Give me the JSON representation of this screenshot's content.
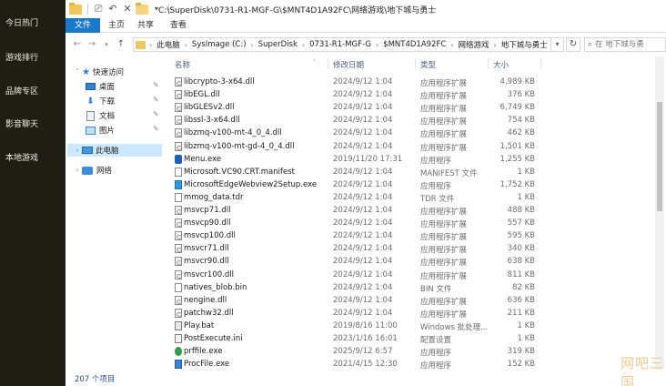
{
  "launcher": {
    "items": [
      "今日热门",
      "游戏排行",
      "品牌专区",
      "影音聊天",
      "本地游戏"
    ]
  },
  "titlebar": {
    "path": "C:\\SuperDisk\\0731-R1-MGF-G\\$MNT4D1A92FC\\网络游戏\\地下城与勇士",
    "qa_dropdown_icon": "chevron-down-icon"
  },
  "ribbon": {
    "tabs": [
      "文件",
      "主页",
      "共享",
      "查看"
    ]
  },
  "address": {
    "crumbs": [
      "此电脑",
      "SysImage (C:)",
      "SuperDisk",
      "0731-R1-MGF-G",
      "$MNT4D1A92FC",
      "网络游戏",
      "地下城与勇士"
    ],
    "search_placeholder": "在 地下城与勇"
  },
  "navpane": {
    "quick_access": "快速访问",
    "desktop": "桌面",
    "downloads": "下载",
    "documents": "文档",
    "pictures": "图片",
    "this_pc": "此电脑",
    "network": "网络"
  },
  "columns": {
    "name": "名称",
    "date": "修改日期",
    "type": "类型",
    "size": "大小"
  },
  "files": [
    {
      "name": "libcrypto-3-x64.dll",
      "date": "2024/9/12 1:04",
      "type": "应用程序扩展",
      "size": "4,989 KB",
      "icon": "dll"
    },
    {
      "name": "libEGL.dll",
      "date": "2024/9/12 1:04",
      "type": "应用程序扩展",
      "size": "376 KB",
      "icon": "dll"
    },
    {
      "name": "libGLESv2.dll",
      "date": "2024/9/12 1:04",
      "type": "应用程序扩展",
      "size": "6,749 KB",
      "icon": "dll"
    },
    {
      "name": "libssl-3-x64.dll",
      "date": "2024/9/12 1:04",
      "type": "应用程序扩展",
      "size": "754 KB",
      "icon": "dll"
    },
    {
      "name": "libzmq-v100-mt-4_0_4.dll",
      "date": "2024/9/12 1:04",
      "type": "应用程序扩展",
      "size": "462 KB",
      "icon": "dll"
    },
    {
      "name": "libzmq-v100-mt-gd-4_0_4.dll",
      "date": "2024/9/12 1:04",
      "type": "应用程序扩展",
      "size": "1,501 KB",
      "icon": "dll"
    },
    {
      "name": "Menu.exe",
      "date": "2019/11/20 17:31",
      "type": "应用程序",
      "size": "1,255 KB",
      "icon": "menu"
    },
    {
      "name": "Microsoft.VC90.CRT.manifest",
      "date": "2024/9/12 1:04",
      "type": "MANIFEST 文件",
      "size": "1 KB",
      "icon": "doc"
    },
    {
      "name": "MicrosoftEdgeWebview2Setup.exe",
      "date": "2024/9/12 1:04",
      "type": "应用程序",
      "size": "1,752 KB",
      "icon": "exe2"
    },
    {
      "name": "mmog_data.tdr",
      "date": "2024/9/12 1:04",
      "type": "TDR 文件",
      "size": "1 KB",
      "icon": "doc"
    },
    {
      "name": "msvcp71.dll",
      "date": "2024/9/12 1:04",
      "type": "应用程序扩展",
      "size": "488 KB",
      "icon": "dll"
    },
    {
      "name": "msvcp90.dll",
      "date": "2024/9/12 1:04",
      "type": "应用程序扩展",
      "size": "557 KB",
      "icon": "dll"
    },
    {
      "name": "msvcp100.dll",
      "date": "2024/9/12 1:04",
      "type": "应用程序扩展",
      "size": "595 KB",
      "icon": "dll"
    },
    {
      "name": "msvcr71.dll",
      "date": "2024/9/12 1:04",
      "type": "应用程序扩展",
      "size": "340 KB",
      "icon": "dll"
    },
    {
      "name": "msvcr90.dll",
      "date": "2024/9/12 1:04",
      "type": "应用程序扩展",
      "size": "638 KB",
      "icon": "dll"
    },
    {
      "name": "msvcr100.dll",
      "date": "2024/9/12 1:04",
      "type": "应用程序扩展",
      "size": "811 KB",
      "icon": "dll"
    },
    {
      "name": "natives_blob.bin",
      "date": "2024/9/12 1:04",
      "type": "BIN 文件",
      "size": "82 KB",
      "icon": "doc"
    },
    {
      "name": "nengine.dll",
      "date": "2024/9/12 1:04",
      "type": "应用程序扩展",
      "size": "636 KB",
      "icon": "dll"
    },
    {
      "name": "patchw32.dll",
      "date": "2024/9/12 1:04",
      "type": "应用程序扩展",
      "size": "211 KB",
      "icon": "dll"
    },
    {
      "name": "Play.bat",
      "date": "2019/8/16 11:00",
      "type": "Windows 批处理...",
      "size": "1 KB",
      "icon": "bat"
    },
    {
      "name": "PostExecute.ini",
      "date": "2023/1/16 16:01",
      "type": "配置设置",
      "size": "1 KB",
      "icon": "ini"
    },
    {
      "name": "prffile.exe",
      "date": "2025/9/12 6:57",
      "type": "应用程序",
      "size": "319 KB",
      "icon": "prf"
    },
    {
      "name": "ProcFile.exe",
      "date": "2021/4/15 12:30",
      "type": "应用程序",
      "size": "152 KB",
      "icon": "pe"
    }
  ],
  "status": {
    "count": "207 个项目"
  },
  "watermark": "网吧三国"
}
